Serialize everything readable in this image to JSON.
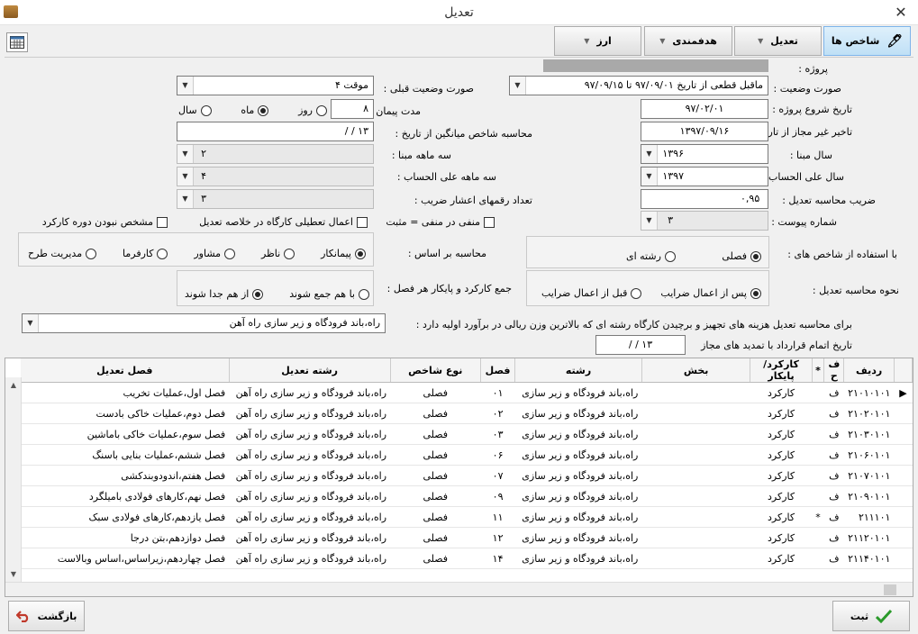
{
  "window": {
    "title": "تعدیل",
    "close": "✕"
  },
  "tabs": [
    {
      "label": "شاخص ها"
    },
    {
      "label": "تعدیل"
    },
    {
      "label": "هدفمندی"
    },
    {
      "label": "ارز"
    }
  ],
  "form": {
    "project_label": "پروژه :",
    "status_label": "صورت وضعیت :",
    "status_value": "ماقبل قطعی از تاریخ ۹۷/۰۹/۰۱ تا ۹۷/۰۹/۱۵",
    "prev_status_label": "صورت وضعیت قبلی :",
    "prev_status_value": "موقت ۴",
    "start_date_label": "تاریخ شروع پروژه :",
    "start_date_value": "۹۷/۰۲/۰۱",
    "contract_duration_label": "مدت پیمان :",
    "contract_duration_value": "۸",
    "unit_day": "روز",
    "unit_month": "ماه",
    "unit_year": "سال",
    "delay_label": "تاخیر غیر مجاز از تاریخ :",
    "delay_value": "۱۳۹۷/۰۹/۱۶",
    "avg_index_label": "محاسبه شاخص میانگین از تاریخ :",
    "avg_index_value": "۱۳ /  /",
    "base_year_label": "سال مبنا :",
    "base_year_value": "۱۳۹۶",
    "base_quarter_label": "سه ماهه مبنا :",
    "base_quarter_value": "۲",
    "account_year_label": "سال علی الحساب :",
    "account_year_value": "۱۳۹۷",
    "account_quarter_label": "سه ماهه علی الحساب :",
    "account_quarter_value": "۴",
    "coef_label": "ضریب محاسبه تعدیل :",
    "coef_value": "۰,۹۵",
    "decimals_label": "تعداد رقمهای اعشار ضریب :",
    "decimals_value": "۳",
    "annex_label": "شماره پیوست :",
    "annex_value": "۳",
    "neg_positive_label": "منفی در منفی = مثبت",
    "workshop_holidays_label": "اعمال تعطیلی کارگاه در خلاصه تعدیل",
    "unspecified_period_label": "مشخص نبودن دوره کارکرد",
    "calc_basis_label": "محاسبه بر اساس :",
    "basis_options": [
      "پیمانکار",
      "ناظر",
      "مشاور",
      "کارفرما",
      "مدیریت طرح"
    ],
    "use_index_label": "با استفاده از شاخص های :",
    "index_options": [
      "فصلی",
      "رشته ای"
    ],
    "sum_label": "جمع کارکرد و پایکار هر فصل :",
    "sum_options": [
      "از هم جدا شوند",
      "با هم جمع شوند"
    ],
    "method_label": "نحوه محاسبه تعدیل :",
    "method_options": [
      "پس از اعمال ضرایب",
      "قبل از اعمال ضرایب"
    ],
    "equipment_label": "برای محاسبه تعدیل هزینه های تجهیز و برچیدن کارگاه رشته ای که بالاترین وزن ریالی در برآورد اولیه دارد :",
    "equipment_value": "راه،باند فرودگاه و زیر سازی راه آهن",
    "completion_label": "تاریخ اتمام قرارداد با تمدید های مجاز",
    "completion_value": "۱۳ /  /"
  },
  "grid": {
    "headers": [
      "ردیف",
      "ف ح",
      "*",
      "کارکرد/پایکار",
      "بخش",
      "رشته",
      "فصل",
      "نوع شاخص",
      "رشته تعدیل",
      "فصل تعدیل"
    ],
    "rows": [
      {
        "id": "۲۱۰۱۰۱۰۱",
        "fh": "ف",
        "star": "",
        "type": "کارکرد",
        "field": "راه،باند فرودگاه و زیر سازی",
        "season": "۰۱",
        "index_type": "فصلی",
        "adj_field": "راه،باند فرودگاه و زیر سازی راه آهن",
        "adj_season": "فصل اول،عملیات تخریب"
      },
      {
        "id": "۲۱۰۲۰۱۰۱",
        "fh": "ف",
        "star": "",
        "type": "کارکرد",
        "field": "راه،باند فرودگاه و زیر سازی",
        "season": "۰۲",
        "index_type": "فصلی",
        "adj_field": "راه،باند فرودگاه و زیر سازی راه آهن",
        "adj_season": "فصل دوم،عملیات خاکی بادست"
      },
      {
        "id": "۲۱۰۳۰۱۰۱",
        "fh": "ف",
        "star": "",
        "type": "کارکرد",
        "field": "راه،باند فرودگاه و زیر سازی",
        "season": "۰۳",
        "index_type": "فصلی",
        "adj_field": "راه،باند فرودگاه و زیر سازی راه آهن",
        "adj_season": "فصل سوم،عملیات خاکی باماشین"
      },
      {
        "id": "۲۱۰۶۰۱۰۱",
        "fh": "ف",
        "star": "",
        "type": "کارکرد",
        "field": "راه،باند فرودگاه و زیر سازی",
        "season": "۰۶",
        "index_type": "فصلی",
        "adj_field": "راه،باند فرودگاه و زیر سازی راه آهن",
        "adj_season": "فصل ششم،عملیات بنایی باسنگ"
      },
      {
        "id": "۲۱۰۷۰۱۰۱",
        "fh": "ف",
        "star": "",
        "type": "کارکرد",
        "field": "راه،باند فرودگاه و زیر سازی",
        "season": "۰۷",
        "index_type": "فصلی",
        "adj_field": "راه،باند فرودگاه و زیر سازی راه آهن",
        "adj_season": "فصل هفتم،اندودوبندکشی"
      },
      {
        "id": "۲۱۰۹۰۱۰۱",
        "fh": "ف",
        "star": "",
        "type": "کارکرد",
        "field": "راه،باند فرودگاه و زیر سازی",
        "season": "۰۹",
        "index_type": "فصلی",
        "adj_field": "راه،باند فرودگاه و زیر سازی راه آهن",
        "adj_season": "فصل نهم،کارهای فولادی بامیلگرد"
      },
      {
        "id": "۲۱۱۱۰۱",
        "fh": "ف",
        "star": "*",
        "type": "کارکرد",
        "field": "راه،باند فرودگاه و زیر سازی",
        "season": "۱۱",
        "index_type": "فصلی",
        "adj_field": "راه،باند فرودگاه و زیر سازی راه آهن",
        "adj_season": "فصل یازدهم،کارهای فولادی سبک"
      },
      {
        "id": "۲۱۱۲۰۱۰۱",
        "fh": "ف",
        "star": "",
        "type": "کارکرد",
        "field": "راه،باند فرودگاه و زیر سازی",
        "season": "۱۲",
        "index_type": "فصلی",
        "adj_field": "راه،باند فرودگاه و زیر سازی راه آهن",
        "adj_season": "فصل دوازدهم،بتن درجا"
      },
      {
        "id": "۲۱۱۴۰۱۰۱",
        "fh": "ف",
        "star": "",
        "type": "کارکرد",
        "field": "راه،باند فرودگاه و زیر سازی",
        "season": "۱۴",
        "index_type": "فصلی",
        "adj_field": "راه،باند فرودگاه و زیر سازی راه آهن",
        "adj_season": "فصل چهاردهم،زیراساس،اساس وبالاست"
      }
    ]
  },
  "buttons": {
    "save": "ثبت",
    "back": "بازگشت"
  }
}
